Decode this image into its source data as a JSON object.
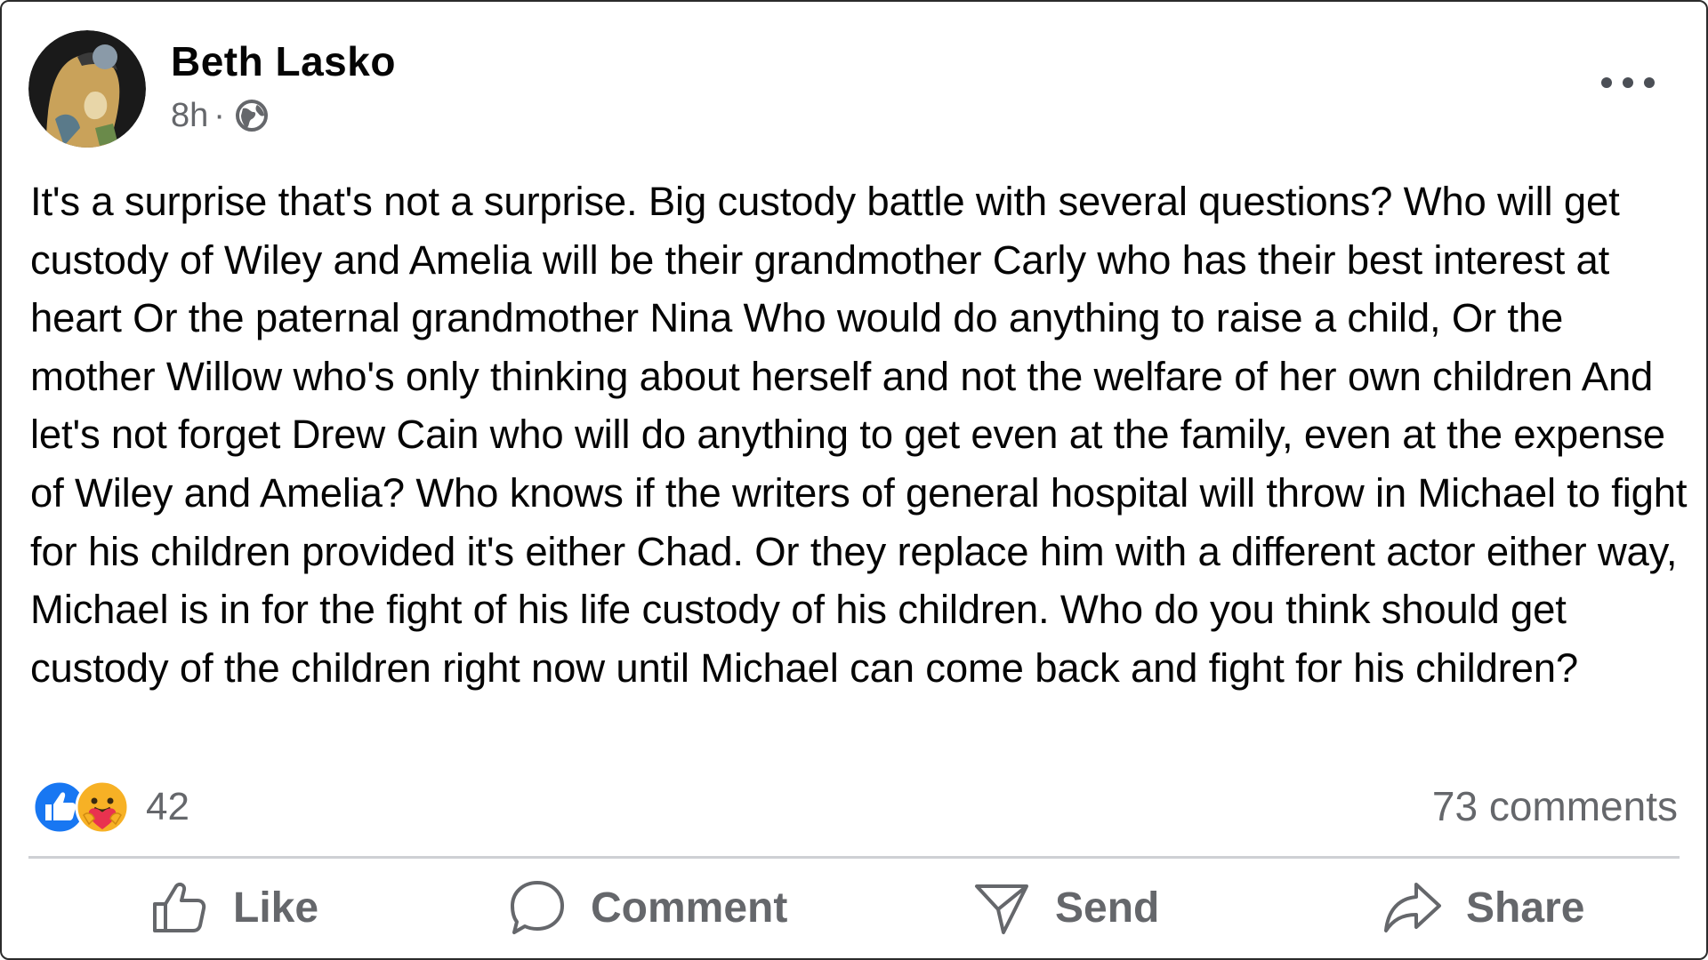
{
  "post": {
    "author": "Beth Lasko",
    "time": "8h",
    "separator": "·",
    "privacy_icon": "globe-icon",
    "body": "It's a surprise that's not a surprise. Big custody battle with several questions? Who will get custody of Wiley and Amelia will be their grandmother Carly who has their best interest at heart Or the paternal grandmother Nina Who would do anything to raise a child, Or the mother Willow who's only thinking about herself and not the welfare of her own children And let's not forget Drew Cain who will do anything to get even at the family, even at the expense of Wiley and Amelia? Who knows if the writers of general hospital will throw in Michael to fight for his children provided it's either Chad. Or they replace him with a different actor either way, Michael is in for the fight of his life custody of his children. Who do you think should get custody of the children right now until Michael can come back and fight for his children?"
  },
  "reactions": {
    "icons": [
      "like-icon",
      "care-icon"
    ],
    "count": "42",
    "comments": "73 comments"
  },
  "actions": {
    "like": "Like",
    "comment": "Comment",
    "send": "Send",
    "share": "Share"
  },
  "colors": {
    "text": "#050505",
    "secondary": "#65676b",
    "like_blue": "#1877f2",
    "divider": "#ced0d4"
  }
}
